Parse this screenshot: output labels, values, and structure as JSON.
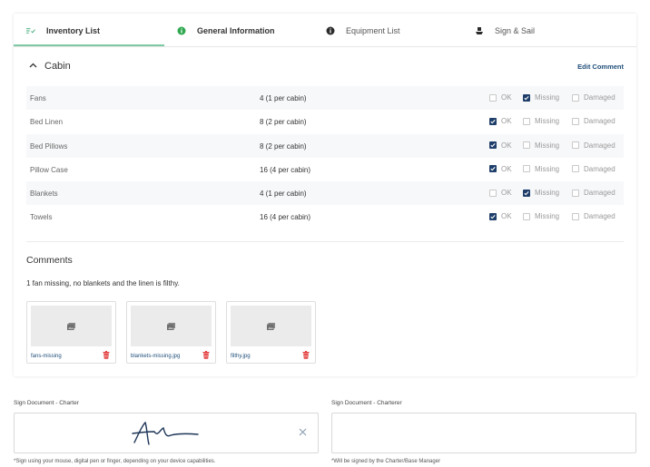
{
  "tabs": [
    {
      "label": "Inventory List",
      "icon": "checklist-icon"
    },
    {
      "label": "General Information",
      "icon": "info-circle-icon"
    },
    {
      "label": "Equipment List",
      "icon": "info-circle-icon"
    },
    {
      "label": "Sign & Sail",
      "icon": "boat-icon"
    }
  ],
  "section": {
    "title": "Cabin",
    "edit_comment": "Edit Comment"
  },
  "options": {
    "ok": "OK",
    "missing": "Missing",
    "damaged": "Damaged"
  },
  "items": [
    {
      "name": "Fans",
      "qty": "4 (1 per cabin)",
      "status": "missing"
    },
    {
      "name": "Bed Linen",
      "qty": "8 (2 per cabin)",
      "status": "ok"
    },
    {
      "name": "Bed Pillows",
      "qty": "8 (2 per cabin)",
      "status": "ok"
    },
    {
      "name": "Pillow Case",
      "qty": "16 (4 per cabin)",
      "status": "ok"
    },
    {
      "name": "Blankets",
      "qty": "4 (1 per cabin)",
      "status": "missing"
    },
    {
      "name": "Towels",
      "qty": "16 (4 per cabin)",
      "status": "ok"
    }
  ],
  "comments": {
    "title": "Comments",
    "text": "1 fan missing, no blankets and the linen is filthy.",
    "attachments": [
      {
        "filename": "fans-missing"
      },
      {
        "filename": "blankets-missing.jpg"
      },
      {
        "filename": "filthy.jpg"
      }
    ]
  },
  "sign": {
    "charter_label": "Sign Document - Charter",
    "charter_note": "*Sign using your mouse, digital pen or finger, depending on your device capabilities.",
    "charterer_label": "Sign Document - Charterer",
    "charterer_note": "*Will be signed by the Charter/Base Manager"
  },
  "colors": {
    "accent_green": "#7dc9a4",
    "checkbox_checked": "#1f3f6a",
    "link": "#1f4e79",
    "delete_red": "#e23b3b",
    "info_green": "#2fa84f"
  }
}
